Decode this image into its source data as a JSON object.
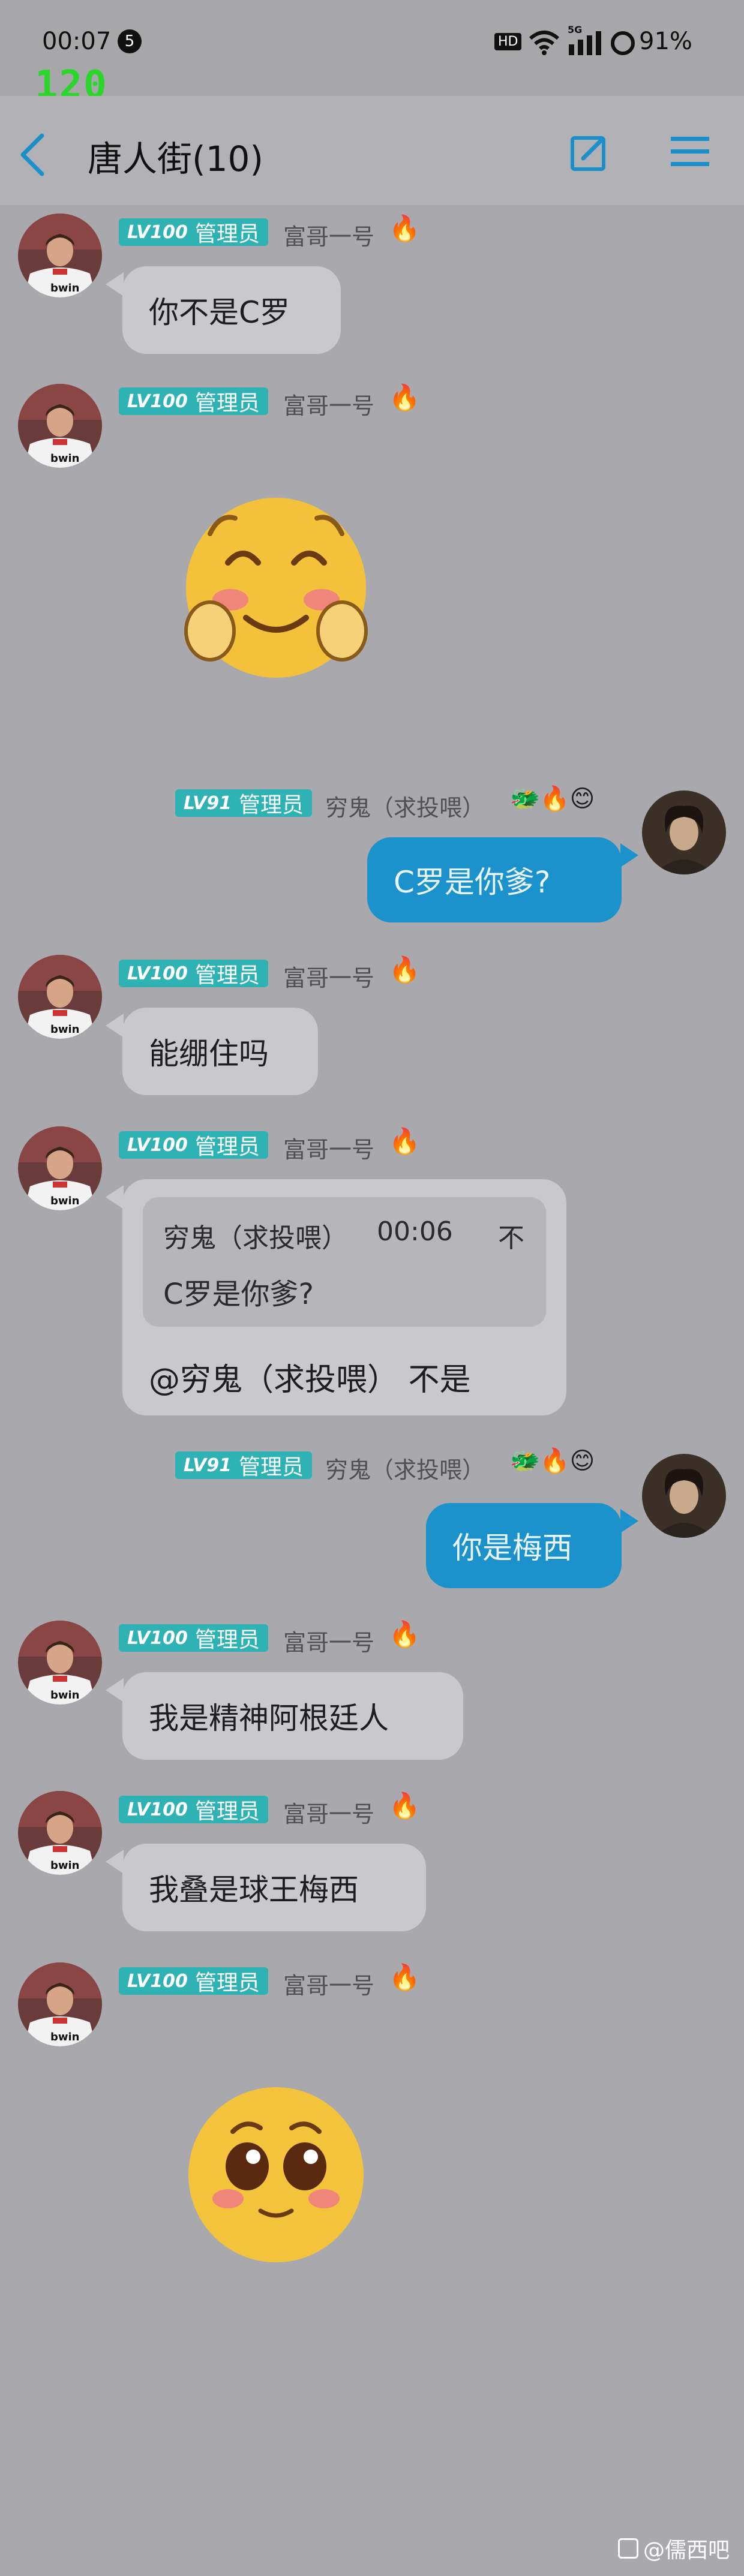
{
  "status_bar": {
    "time": "00:07",
    "notification_count": "5",
    "fps": "120",
    "hd_label": "HD",
    "network": "5G",
    "battery": "91%"
  },
  "header": {
    "title": "唐人街(10)",
    "back_icon": "chevron-left-icon",
    "edit_icon": "edit-icon",
    "menu_icon": "menu-icon"
  },
  "users": {
    "fuge": {
      "level": "LV100",
      "role": "管理员",
      "name": "富哥一号"
    },
    "qionggui": {
      "level": "LV91",
      "role": "管理员",
      "name": "穷鬼（求投喂）"
    }
  },
  "messages": [
    {
      "sender": "富哥一号",
      "text": "你不是C罗"
    },
    {
      "sender": "富哥一号",
      "sticker": "blushing-face-emoji"
    },
    {
      "sender": "穷鬼（求投喂）",
      "text": "C罗是你爹?"
    },
    {
      "sender": "富哥一号",
      "text": "能绷住吗"
    },
    {
      "sender": "富哥一号",
      "quote": {
        "name": "穷鬼（求投喂）",
        "time": "00:06",
        "tag": "不",
        "text": "C罗是你爹?"
      },
      "text": "@穷鬼（求投喂） 不是"
    },
    {
      "sender": "穷鬼（求投喂）",
      "text": "你是梅西"
    },
    {
      "sender": "富哥一号",
      "text": "我是精神阿根廷人"
    },
    {
      "sender": "富哥一号",
      "text": "我叠是球王梅西"
    },
    {
      "sender": "富哥一号",
      "sticker": "pleading-face-emoji"
    }
  ],
  "watermark": "@儒西吧",
  "colors": {
    "badge": "#2fb2b4",
    "right_bubble": "#1b92cc",
    "left_bubble": "#c9c9cd",
    "background": "#a9a9ad",
    "accent": "#1b8fc9"
  }
}
